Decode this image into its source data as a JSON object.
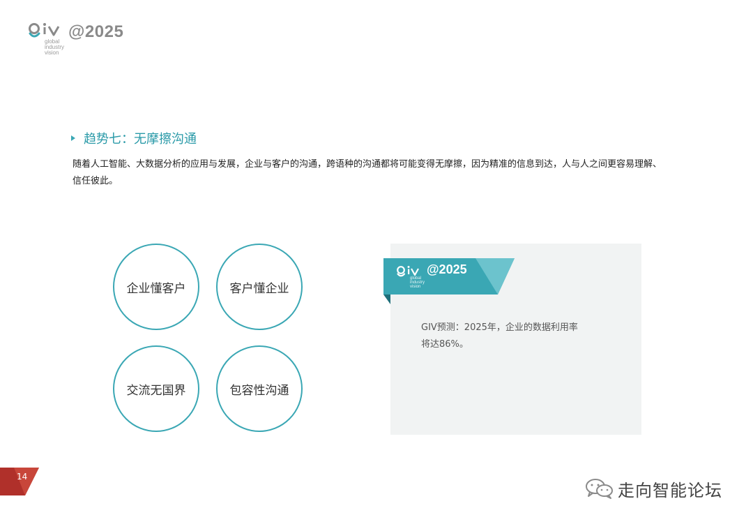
{
  "logo": {
    "year": "@2025",
    "subtitle": [
      "global",
      "industry",
      "vision"
    ]
  },
  "section": {
    "title": "趋势七：无摩擦沟通",
    "paragraph": "随着人工智能、大数据分析的应用与发展，企业与客户的沟通，跨语种的沟通都将可能变得无摩擦，因为精准的信息到达，人与人之间更容易理解、信任彼此。"
  },
  "circles": [
    "企业懂客户",
    "客户懂企业",
    "交流无国界",
    "包容性沟通"
  ],
  "card": {
    "logo_year": "@2025",
    "logo_subtitle": [
      "global",
      "industry",
      "vision"
    ],
    "text_line1": "GIV预测：2025年，企业的数据利用率",
    "text_line2": "将达86%。"
  },
  "page_number": "14",
  "watermark": "走向智能论坛",
  "colors": {
    "accent": "#3aa7b4",
    "badge": "#b0302a"
  }
}
